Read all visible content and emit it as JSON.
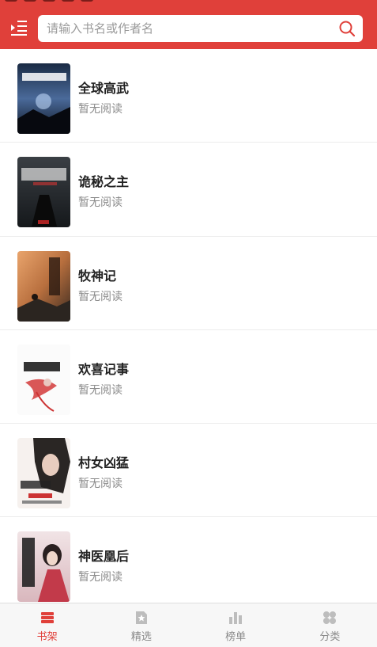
{
  "colors": {
    "accent": "#e0403a",
    "inactive": "#bdbdbd"
  },
  "search": {
    "placeholder": "请输入书名或作者名"
  },
  "books": [
    {
      "title": "全球高武",
      "progress": "暂无阅读"
    },
    {
      "title": "诡秘之主",
      "progress": "暂无阅读"
    },
    {
      "title": "牧神记",
      "progress": "暂无阅读"
    },
    {
      "title": "欢喜记事",
      "progress": "暂无阅读"
    },
    {
      "title": "村女凶猛",
      "progress": "暂无阅读"
    },
    {
      "title": "神医凰后",
      "progress": "暂无阅读"
    }
  ],
  "tabs": [
    {
      "label": "书架",
      "icon": "bookshelf-icon",
      "active": true
    },
    {
      "label": "精选",
      "icon": "star-document-icon",
      "active": false
    },
    {
      "label": "榜单",
      "icon": "bar-chart-icon",
      "active": false
    },
    {
      "label": "分类",
      "icon": "grid-icon",
      "active": false
    }
  ]
}
